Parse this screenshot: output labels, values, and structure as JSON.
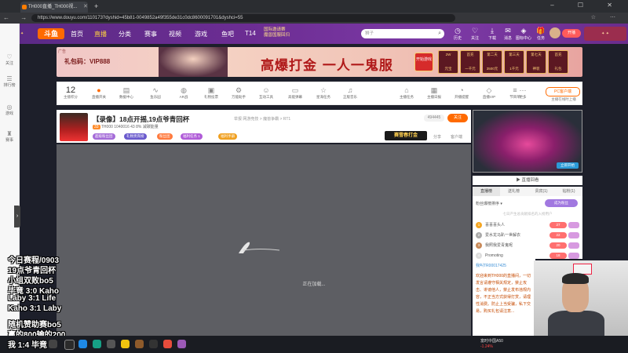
{
  "browser": {
    "tab_title": "TH000直播_TH000视...",
    "url": "https://www.douyu.com/110173?dyshid=45b81-0049852a49f355de31c0dc8600091701&dyshci=55"
  },
  "site": {
    "nav": [
      "首页",
      "直播",
      "分类",
      "赛事",
      "视频",
      "游戏",
      "鱼吧",
      "T14"
    ],
    "notice_line1": "国际邀请赛",
    "notice_line2": "魔兽国服回归",
    "search_placeholder": "狮子",
    "top_icons": [
      "历史",
      "关注",
      "下载",
      "消息",
      "图标中心",
      "任务"
    ],
    "open_label": "开播"
  },
  "leftbar": {
    "items": [
      "关注",
      "排行榜",
      "游戏",
      "赛事"
    ]
  },
  "banner": {
    "ad": "广告",
    "gift": "礼包码：VIP888",
    "slogan": "高爆打金 一人一鬼服",
    "start": "开始游戏",
    "prizes": [
      {
        "top": "2W",
        "bottom": "元宝"
      },
      {
        "top": "首充",
        "bottom": "一千元"
      },
      {
        "top": "第二天",
        "bottom": "3500元"
      },
      {
        "top": "第三天",
        "bottom": "1千元"
      },
      {
        "top": "第七天",
        "bottom": "神装"
      },
      {
        "top": "首充",
        "bottom": "礼包"
      },
      {
        "top": "领取",
        "bottom": "福利"
      }
    ]
  },
  "toolbar": {
    "level": "12",
    "level_label": "主播积分",
    "items": [
      "直播开关",
      "数据中心",
      "鱼乐园",
      "AR战",
      "礼物投票",
      "万能助手",
      "互动工具",
      "高能弹幕",
      "星海任务",
      "正版音乐",
      "主播任务",
      "主播日报",
      "开播提醒",
      "直播VIP",
      "节目单",
      "更多"
    ],
    "pc_btn": "PC客户端",
    "pc_sub": "主播在线时上播"
  },
  "stream": {
    "title": "【录像】18点开摇,19点爷青回杯",
    "report": "举报",
    "category": "网游竞技 > 魔兽争霸 > RT1",
    "streamer_level": "33",
    "streamer_name": "TH000",
    "room_id": "1040016",
    "stats": "43 8% 减碳能量",
    "fans": "494445",
    "follow": "关注",
    "badges": [
      "超级粉丝团",
      "礼物贵宾榜",
      "粉丝团",
      "福利任务 1",
      "福利手册"
    ],
    "ad_game": "赛雪春打金",
    "share": "分享",
    "client": "客户端"
  },
  "player": {
    "loading": "正在加载..."
  },
  "right": {
    "thumb_btn": "立即开始",
    "replay": "直播回看",
    "tabs": [
      "直播榜",
      "送礼榜",
      "贵宾(1)",
      "钻粉(1)"
    ],
    "rank_head": "粉丝爆榜排序 ▾",
    "rank_join": "成为粉丝",
    "rank_tip": "七日产生总贡献排名的入榜用户",
    "rank": [
      {
        "n": "1",
        "name": "喜喜喜头人",
        "lvl": "27"
      },
      {
        "n": "2",
        "name": "爱水龙马趴一世解衣",
        "lvl": "22"
      },
      {
        "n": "3",
        "name": "我照我爱青鬼呢",
        "lvl": "20"
      },
      {
        "n": "4",
        "name": "Promoting",
        "lvl": "18"
      }
    ],
    "chat_user": "我叫TR00017425",
    "chat_msg": "欢迎来到TH000的直播间，一切发言请遵守相关规定，禁止攻击、诽谤他人，禁止发布违规内容，不正当方式获得打赏，请理性消费。防止上当受骗，私下交易，购买礼包请注意..."
  },
  "overlay": [
    "今日赛程/0903",
    "19点爷青回杯",
    "小组双败bo5",
    "毕竟 3:0 Kaho",
    "Laby 3:1 Life",
    "Kaho 3:1 Laby",
    "",
    "随机赞助赛bo5",
    "赢的800输的200",
    "我    1:4 毕竟"
  ],
  "taskbar": {
    "stock_name": "富时中国A50",
    "stock_change": "-1.24%"
  },
  "colors": {
    "nav_purple": "#6c2d93",
    "accent_orange": "#ff6a00",
    "player_bg": "#5d5e63"
  }
}
